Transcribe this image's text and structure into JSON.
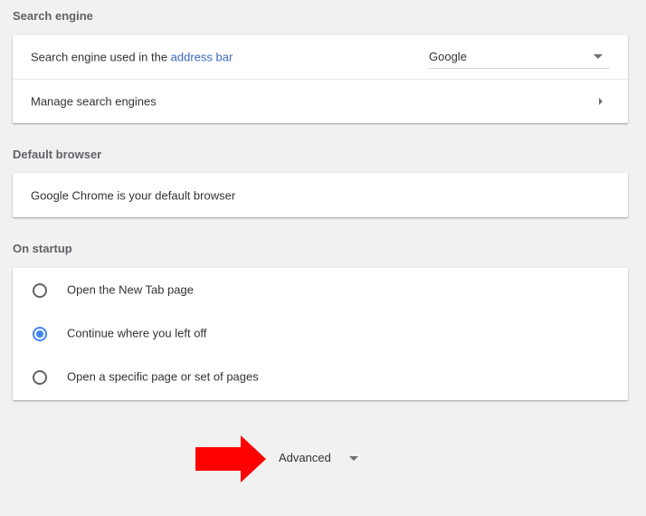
{
  "search_engine": {
    "title": "Search engine",
    "used_in_prefix": "Search engine used in the ",
    "used_in_link": "address bar",
    "selected_engine": "Google",
    "manage_label": "Manage search engines"
  },
  "default_browser": {
    "title": "Default browser",
    "status": "Google Chrome is your default browser"
  },
  "on_startup": {
    "title": "On startup",
    "options": [
      {
        "label": "Open the New Tab page",
        "checked": false
      },
      {
        "label": "Continue where you left off",
        "checked": true
      },
      {
        "label": "Open a specific page or set of pages",
        "checked": false
      }
    ]
  },
  "advanced": {
    "label": "Advanced"
  },
  "colors": {
    "accent": "#4285f4",
    "link": "#3b67c4",
    "annotation_arrow": "#ff0000"
  }
}
